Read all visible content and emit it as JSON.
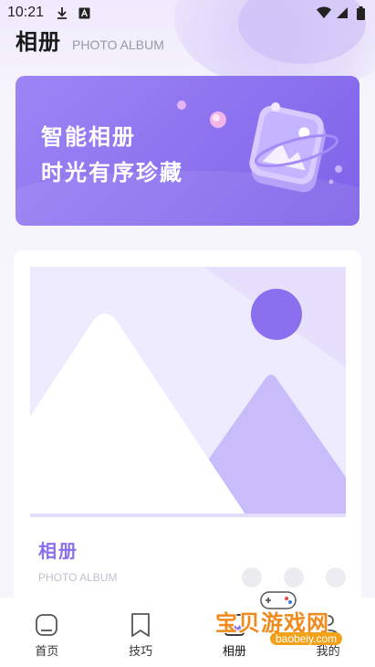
{
  "status_bar": {
    "time": "10:21",
    "icons_left": [
      "download-icon",
      "font-icon"
    ],
    "icons_right": [
      "wifi-icon",
      "signal-icon",
      "battery-icon"
    ]
  },
  "header": {
    "title": "相册",
    "subtitle": "PHOTO ALBUM"
  },
  "banner": {
    "line1": "智能相册",
    "line2": "时光有序珍藏",
    "color": "#8a70ee"
  },
  "card": {
    "title": "相册",
    "subtitle": "PHOTO ALBUM",
    "dot_count": 3
  },
  "bottom_nav": {
    "items": [
      {
        "label": "首页",
        "icon": "home-icon"
      },
      {
        "label": "技巧",
        "icon": "bookmark-icon"
      },
      {
        "label": "相册",
        "icon": "album-icon",
        "active": true
      },
      {
        "label": "我的",
        "icon": "profile-icon"
      }
    ]
  },
  "watermark": {
    "text": "宝贝游戏网",
    "url": "baobeiy.com"
  },
  "colors": {
    "accent": "#8a70ee",
    "background": "#f6f5fb"
  }
}
